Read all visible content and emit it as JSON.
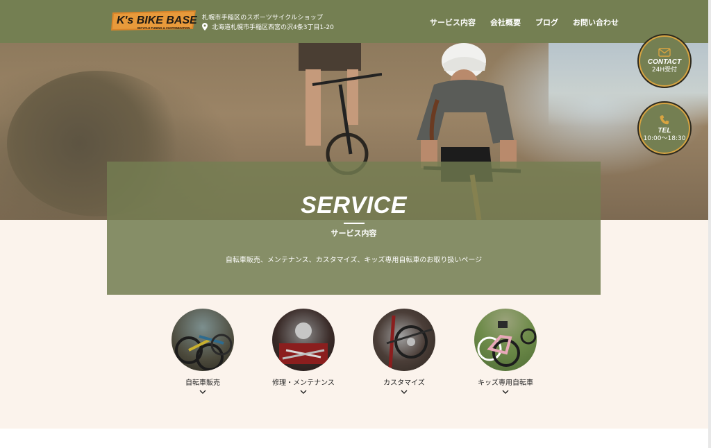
{
  "header": {
    "logo_text": "K's BIKE BASE",
    "logo_tagline": "BICYCLE TUNING & CUSTOMIZATION",
    "shop_description": "札幌市手稲区のスポーツサイクルショップ",
    "address": "北海道札幌市手稲区西宮の沢4条3丁目1-20",
    "nav": [
      {
        "label": "サービス内容"
      },
      {
        "label": "会社概要"
      },
      {
        "label": "ブログ"
      },
      {
        "label": "お問い合わせ"
      }
    ]
  },
  "floating": {
    "contact": {
      "label": "CONTACT",
      "sub": "24H受付",
      "icon": "envelope-icon"
    },
    "tel": {
      "label": "TEL",
      "sub": "10:00〜18:30",
      "icon": "phone-icon"
    }
  },
  "hero": {
    "title": "SERVICE",
    "subtitle": "サービス内容",
    "description": "自転車販売、メンテナンス、カスタマイズ、キッズ専用自転車のお取り扱いページ"
  },
  "categories": [
    {
      "label": "自転車販売"
    },
    {
      "label": "修理・メンテナンス"
    },
    {
      "label": "カスタマイズ"
    },
    {
      "label": "キッズ専用自転車"
    }
  ],
  "colors": {
    "header_bg": "#747f52",
    "overlay_bg": "#868e67",
    "cream_bg": "#fbf3ec",
    "accent_gold": "#d9a441"
  }
}
